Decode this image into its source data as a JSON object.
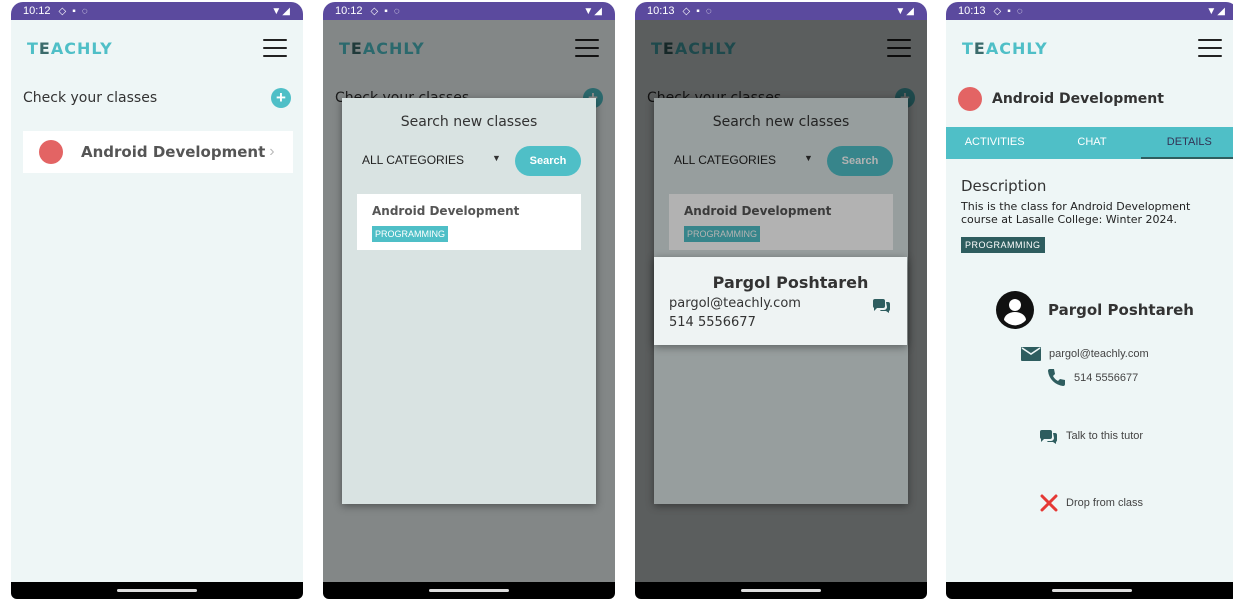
{
  "screens": [
    {
      "status": {
        "time": "10:12"
      },
      "appbar": {
        "logo_pre": "T",
        "logo_e": "E",
        "logo_post": "ACHLY"
      },
      "header": "Check your classes",
      "classes": [
        {
          "name": "Android Development"
        }
      ]
    },
    {
      "status": {
        "time": "10:12"
      },
      "appbar": {
        "logo_pre": "T",
        "logo_e": "E",
        "logo_post": "ACHLY"
      },
      "dialog": {
        "title": "Search new classes",
        "category": "ALL CATEGORIES",
        "search_label": "Search",
        "results": [
          {
            "name": "Android Development",
            "tag": "PROGRAMMING"
          }
        ]
      }
    },
    {
      "status": {
        "time": "10:13"
      },
      "appbar": {
        "logo_pre": "T",
        "logo_e": "E",
        "logo_post": "ACHLY"
      },
      "dialog": {
        "title": "Search new classes",
        "category": "ALL CATEGORIES",
        "search_label": "Search",
        "results": [
          {
            "name": "Android Development",
            "tag": "PROGRAMMING"
          }
        ]
      },
      "tutor_popup": {
        "name": "Pargol Poshtareh",
        "email": "pargol@teachly.com",
        "phone": "514 5556677"
      }
    },
    {
      "status": {
        "time": "10:13"
      },
      "appbar": {
        "logo_pre": "T",
        "logo_e": "E",
        "logo_post": "ACHLY"
      },
      "class_name": "Android Development",
      "tabs": [
        {
          "label": "ACTIVITIES"
        },
        {
          "label": "CHAT"
        },
        {
          "label": "DETAILS"
        }
      ],
      "description_heading": "Description",
      "description_text": "This is the class for Android Development course at Lasalle College: Winter 2024.",
      "tag": "PROGRAMMING",
      "tutor": {
        "name": "Pargol Poshtareh",
        "email": "pargol@teachly.com",
        "phone": "514 5556677"
      },
      "talk_label": "Talk to this tutor",
      "drop_label": "Drop from class"
    }
  ],
  "colors": {
    "accent": "#4fbfc7",
    "dark_teal": "#2e5d5f",
    "status_bar": "#5b4a9e",
    "class_dot": "#e36464",
    "drop_x": "#e53935"
  }
}
